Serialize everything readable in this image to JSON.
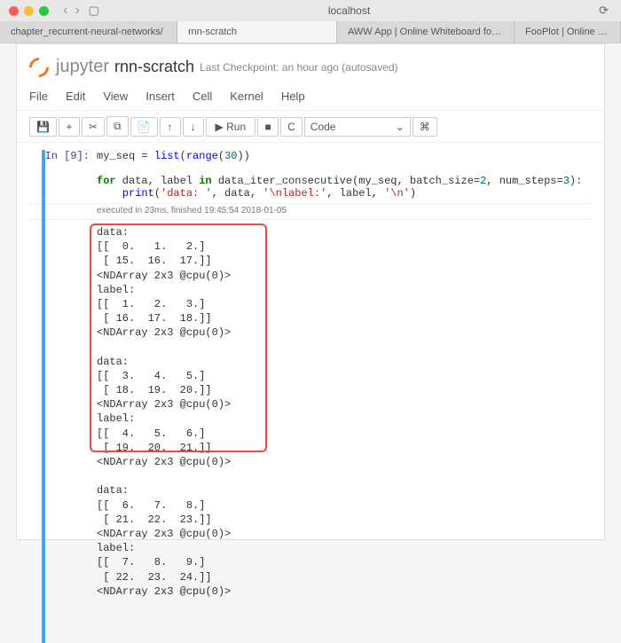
{
  "browser": {
    "address": "localhost",
    "tabs": [
      "chapter_recurrent-neural-networks/",
      "rnn-scratch",
      "AWW App | Online Whiteboard for Re...",
      "FooPlot | Online gra"
    ]
  },
  "header": {
    "brand": "jupyter",
    "docname": "rnn-scratch",
    "lastcp": "Last Checkpoint: an hour ago  (autosaved)"
  },
  "menus": [
    "File",
    "Edit",
    "View",
    "Insert",
    "Cell",
    "Kernel",
    "Help"
  ],
  "toolbar": {
    "run": "▶ Run",
    "celltype": "Code"
  },
  "cell": {
    "prompt": "In [9]:",
    "code": "my_seq = list(range(30))\n\nfor data, label in data_iter_consecutive(my_seq, batch_size=2, num_steps=3):\n    print('data: ', data, '\\nlabel:', label, '\\n')",
    "exec": "executed in 23ms, finished 19:45:54 2018-01-05",
    "output": "data:\n[[  0.   1.   2.]\n [ 15.  16.  17.]]\n<NDArray 2x3 @cpu(0)>\nlabel:\n[[  1.   2.   3.]\n [ 16.  17.  18.]]\n<NDArray 2x3 @cpu(0)>\n\ndata:\n[[  3.   4.   5.]\n [ 18.  19.  20.]]\n<NDArray 2x3 @cpu(0)>\nlabel:\n[[  4.   5.   6.]\n [ 19.  20.  21.]]\n<NDArray 2x3 @cpu(0)>\n\ndata:\n[[  6.   7.   8.]\n [ 21.  22.  23.]]\n<NDArray 2x3 @cpu(0)>\nlabel:\n[[  7.   8.   9.]\n [ 22.  23.  24.]]\n<NDArray 2x3 @cpu(0)>"
  }
}
